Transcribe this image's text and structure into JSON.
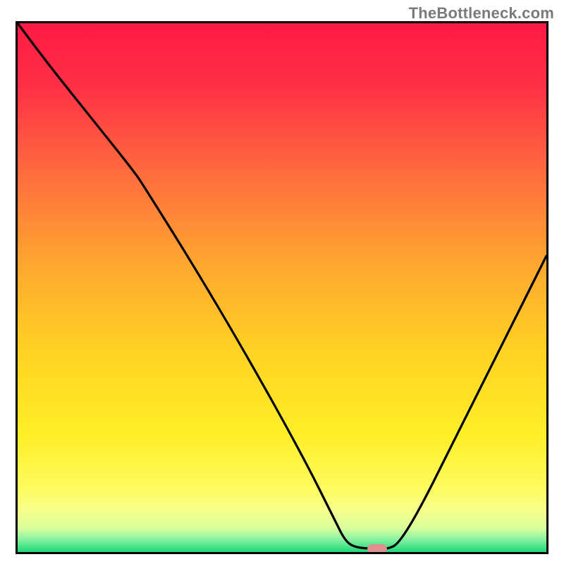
{
  "branding": {
    "watermark": "TheBottleneck.com"
  },
  "chart_data": {
    "type": "line",
    "title": "",
    "xlabel": "",
    "ylabel": "",
    "xlim": [
      0,
      100
    ],
    "ylim": [
      0,
      100
    ],
    "grid": false,
    "legend": false,
    "background": {
      "description": "vertical gradient backdrop from red through orange/yellow to a thin green strip at the bottom",
      "stops": [
        {
          "pos": 0.0,
          "color": "#ff1a44"
        },
        {
          "pos": 0.12,
          "color": "#ff3046"
        },
        {
          "pos": 0.28,
          "color": "#ff6a3e"
        },
        {
          "pos": 0.45,
          "color": "#ffa530"
        },
        {
          "pos": 0.62,
          "color": "#ffd223"
        },
        {
          "pos": 0.78,
          "color": "#ffef28"
        },
        {
          "pos": 0.88,
          "color": "#fffb60"
        },
        {
          "pos": 0.92,
          "color": "#f6ff8a"
        },
        {
          "pos": 0.955,
          "color": "#d9ff9c"
        },
        {
          "pos": 0.975,
          "color": "#8cf3a0"
        },
        {
          "pos": 1.0,
          "color": "#1fd97a"
        }
      ]
    },
    "series": [
      {
        "name": "curve",
        "points": [
          {
            "x": 0,
            "y": 100
          },
          {
            "x": 6,
            "y": 92
          },
          {
            "x": 14,
            "y": 82
          },
          {
            "x": 22,
            "y": 72
          },
          {
            "x": 24,
            "y": 69
          },
          {
            "x": 34,
            "y": 53
          },
          {
            "x": 44,
            "y": 36
          },
          {
            "x": 54,
            "y": 18
          },
          {
            "x": 60,
            "y": 6
          },
          {
            "x": 62,
            "y": 2
          },
          {
            "x": 64,
            "y": 0.8
          },
          {
            "x": 68,
            "y": 0.6
          },
          {
            "x": 70,
            "y": 0.6
          },
          {
            "x": 72,
            "y": 1.5
          },
          {
            "x": 76,
            "y": 8
          },
          {
            "x": 82,
            "y": 20
          },
          {
            "x": 90,
            "y": 36
          },
          {
            "x": 100,
            "y": 56
          }
        ]
      }
    ],
    "marker": {
      "x": 68,
      "y": 0.6,
      "color": "#e28d8f",
      "shape": "pill"
    }
  }
}
